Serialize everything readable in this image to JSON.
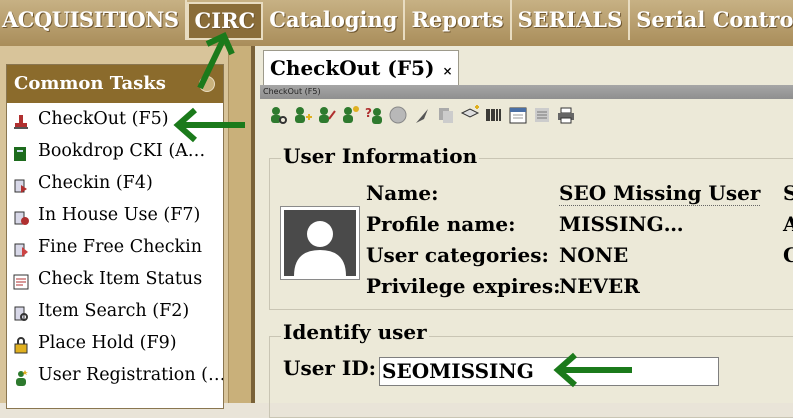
{
  "top_tabs": [
    {
      "label": "ACQUISITIONS"
    },
    {
      "label": "CIRC"
    },
    {
      "label": "Cataloging"
    },
    {
      "label": "Reports"
    },
    {
      "label": "SERIALS"
    },
    {
      "label": "Serial Control"
    }
  ],
  "common_tasks": {
    "header": "Common Tasks",
    "items": [
      {
        "label": "CheckOut (F5)",
        "icon": "checkout-stamp-icon"
      },
      {
        "label": "Bookdrop CKI (A…",
        "icon": "bookdrop-icon"
      },
      {
        "label": "Checkin (F4)",
        "icon": "checkin-icon"
      },
      {
        "label": "In House Use (F7)",
        "icon": "in-house-use-icon"
      },
      {
        "label": "Fine Free Checkin",
        "icon": "fine-free-checkin-icon"
      },
      {
        "label": "Check Item Status",
        "icon": "item-status-icon"
      },
      {
        "label": "Item Search (F2)",
        "icon": "item-search-icon"
      },
      {
        "label": "Place Hold (F9)",
        "icon": "place-hold-icon"
      },
      {
        "label": "User Registration (…",
        "icon": "user-registration-icon"
      }
    ]
  },
  "doc_tab": {
    "label": "CheckOut (F5)",
    "close": "×"
  },
  "title_strip": "CheckOut (F5)",
  "toolbar_icons": [
    "find-user-icon",
    "add-user-icon",
    "edit-user-icon",
    "new-user-icon",
    "help-user-icon",
    "globe-icon",
    "feather-icon",
    "copy-icon",
    "book-add-icon",
    "barcode-icon",
    "calendar-icon",
    "list-icon",
    "print-icon"
  ],
  "user_information": {
    "section_label": "User Information",
    "fields": [
      {
        "label": "Name:",
        "value": "SEO Missing User",
        "extra": "S"
      },
      {
        "label": "Profile name:",
        "value": "MISSING…",
        "extra": "A"
      },
      {
        "label": "User categories:",
        "value": "NONE",
        "extra": "C"
      },
      {
        "label": "Privilege expires:",
        "value": "NEVER",
        "extra": ""
      }
    ]
  },
  "identify_user": {
    "section_label": "Identify user",
    "user_id_label": "User ID:",
    "user_id_value": "SEOMISSING"
  },
  "colors": {
    "topbar": "#a98d5a",
    "panel_header": "#8b6b2c",
    "arrow": "#1b7a1b"
  }
}
